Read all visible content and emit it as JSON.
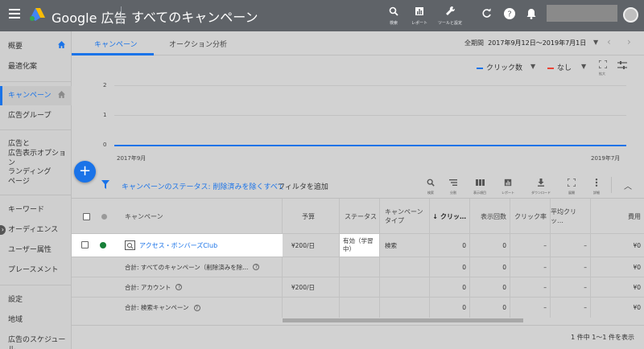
{
  "app": {
    "brand": "Google 広告",
    "page_title": "すべてのキャンペーン"
  },
  "toolbar": {
    "search": "検索",
    "reports": "レポート",
    "tools": "ツールと設定"
  },
  "sidebar": {
    "items": [
      {
        "label": "概要"
      },
      {
        "label": "最適化案"
      },
      {
        "label": "キャンペーン"
      },
      {
        "label": "広告グループ"
      },
      {
        "label": "広告と\n広告表示オプション"
      },
      {
        "label": "ランディング\nページ"
      },
      {
        "label": "キーワード"
      },
      {
        "label": "オーディエンス"
      },
      {
        "label": "ユーザー属性"
      },
      {
        "label": "プレースメント"
      },
      {
        "label": "設定"
      },
      {
        "label": "地域"
      },
      {
        "label": "広告のスケジュール"
      }
    ]
  },
  "tabs": [
    {
      "label": "キャンペーン"
    },
    {
      "label": "オークション分析"
    }
  ],
  "date": {
    "prefix": "全期間",
    "range": "2017年9月12日〜2019年7月1日"
  },
  "chart_controls": {
    "metric1": "クリック数",
    "metric2": "なし",
    "expand": "拡大"
  },
  "chart_data": {
    "type": "line",
    "x": [
      "2017年9月",
      "2019年7月"
    ],
    "series": [
      {
        "name": "クリック数",
        "values": [
          0,
          0
        ]
      }
    ],
    "yticks": [
      "2",
      "1",
      "0"
    ],
    "ylim": [
      0,
      2
    ],
    "colors": {
      "clicks": "#1a73e8",
      "none": "#ea4335"
    }
  },
  "filter": {
    "status_filter": "キャンペーンのステータス: 削除済みを除くすべて",
    "add": "フィルタを追加"
  },
  "filter_tools": [
    "検索",
    "分割",
    "表示項目",
    "レポート",
    "ダウンロード",
    "展開",
    "詳細"
  ],
  "table": {
    "headers": {
      "campaign": "キャンペーン",
      "budget": "予算",
      "status": "ステータス",
      "type": "キャンペーン\nタイプ",
      "clicks": "クリッ…",
      "impr": "表示回数",
      "ctr": "クリック率",
      "cpc": "平均クリッ…",
      "cost": "費用"
    },
    "rows": [
      {
        "name": "アクセス・ボンバーズClub",
        "budget": "¥200/日",
        "status": "有効（学習\n中）",
        "type": "検索",
        "clicks": "0",
        "impr": "0",
        "ctr": "–",
        "cpc": "–",
        "cost": "¥0"
      }
    ],
    "totals": [
      {
        "name": "合計: すべてのキャンペーン（削除済みを除...",
        "budget": "",
        "clicks": "0",
        "impr": "0",
        "ctr": "–",
        "cpc": "–",
        "cost": "¥0"
      },
      {
        "name": "合計: アカウント",
        "budget": "¥200/日",
        "clicks": "0",
        "impr": "0",
        "ctr": "–",
        "cpc": "–",
        "cost": "¥0"
      },
      {
        "name": "合計: 検索キャンペーン",
        "budget": "",
        "clicks": "0",
        "impr": "0",
        "ctr": "–",
        "cpc": "–",
        "cost": "¥0"
      }
    ]
  },
  "pager": {
    "text": "1 件中 1〜1 件を表示"
  },
  "colors": {
    "accent": "#1a73e8",
    "enabled": "#188038",
    "topbar": "#5f6368"
  }
}
